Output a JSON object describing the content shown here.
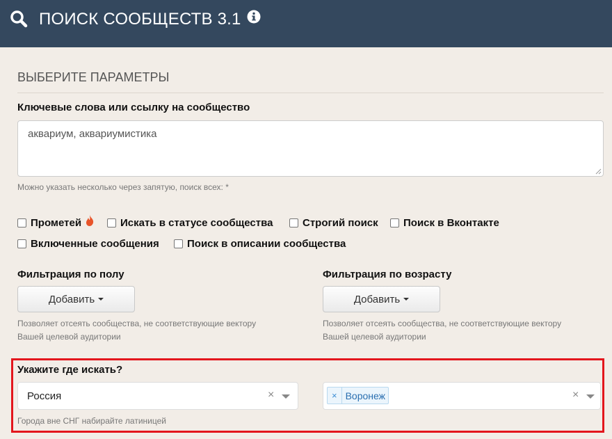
{
  "header": {
    "title": "ПОИСК СООБЩЕСТВ 3.1"
  },
  "section": {
    "title": "ВЫБЕРИТЕ ПАРАМЕТРЫ"
  },
  "keywords": {
    "label": "Ключевые слова или ссылку на сообщество",
    "value": "аквариум, аквариумистика",
    "help": "Можно указать несколько через запятую, поиск всех: *"
  },
  "options": [
    {
      "label": "Прометей",
      "checked": false
    },
    {
      "label": "Искать в статусе сообщества",
      "checked": false
    },
    {
      "label": "Строгий поиск",
      "checked": false
    },
    {
      "label": "Поиск в Вконтакте",
      "checked": false
    },
    {
      "label": "Включенные сообщения",
      "checked": false
    },
    {
      "label": "Поиск в описании сообщества",
      "checked": false
    }
  ],
  "gender_filter": {
    "label": "Фильтрация по полу",
    "button": "Добавить",
    "help_line1": "Позволяет отсеять сообщества, не соответствующие вектору",
    "help_line2": "Вашей целевой аудитории"
  },
  "age_filter": {
    "label": "Фильтрация по возрасту",
    "button": "Добавить",
    "help_line1": "Позволяет отсеять сообщества, не соответствующие вектору",
    "help_line2": "Вашей целевой аудитории"
  },
  "location": {
    "label": "Укажите где искать?",
    "country": "Россия",
    "city_tags": [
      "Воронеж"
    ],
    "tag_remove": "×",
    "clear": "×",
    "help": "Города вне СНГ набирайте латиницей"
  },
  "colors": {
    "header_bg": "#34485e",
    "page_bg": "#f2ede7",
    "highlight": "#e3161d",
    "tag_text": "#2a6fb0",
    "fire": "#e8542a"
  }
}
